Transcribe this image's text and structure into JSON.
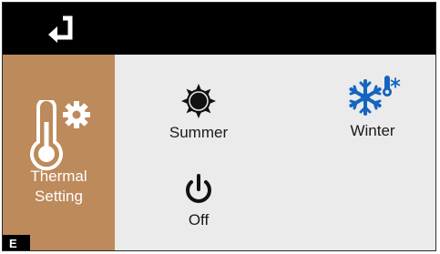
{
  "sidebar": {
    "label_line1": "Thermal",
    "label_line2": "Setting",
    "icon": "thermometer-gear-icon"
  },
  "topbar": {
    "back_icon": "back-return-icon"
  },
  "mode_badge": "E",
  "options": {
    "summer": {
      "label": "Summer",
      "icon": "sun-icon"
    },
    "winter": {
      "label": "Winter",
      "icon": "snowflake-thermometer-icon"
    },
    "off": {
      "label": "Off",
      "icon": "power-icon"
    }
  },
  "colors": {
    "sidebar": "#bd8a5b",
    "topbar": "#000000",
    "panel": "#ebebeb",
    "winter_accent": "#1565c0"
  }
}
